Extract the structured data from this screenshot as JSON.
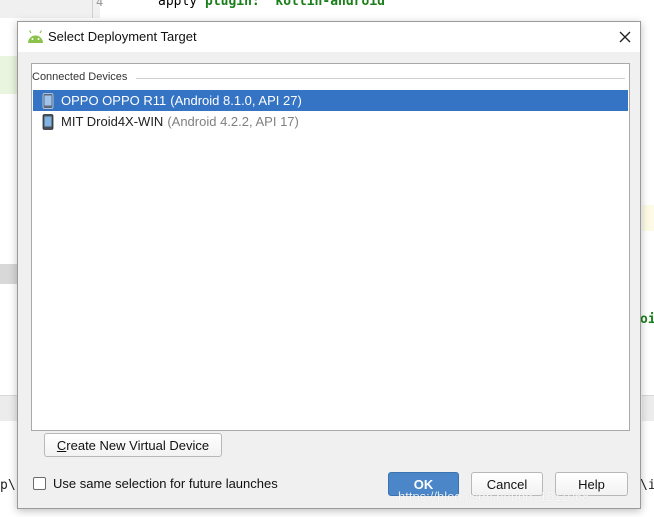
{
  "background": {
    "line_number": "4",
    "code_prefix": "apply ",
    "code_keyword": "plugin: 'kotlin-android'",
    "left_fragment": "p\\",
    "right_fragment_1": "oi",
    "right_fragment_2": "\\i"
  },
  "dialog": {
    "title": "Select Deployment Target",
    "title_icon": "android-icon",
    "close_icon": "close-icon",
    "section_label": "Connected Devices",
    "devices": [
      {
        "name": "OPPO OPPO R11",
        "detail": "(Android 8.1.0, API 27)",
        "selected": true,
        "icon": "phone-icon"
      },
      {
        "name": "MIT Droid4X-WIN",
        "detail": "(Android 4.2.2, API 17)",
        "selected": false,
        "icon": "phone-icon"
      }
    ],
    "create_button": {
      "mnemonic": "C",
      "rest": "reate New Virtual Device"
    },
    "checkbox_label": "Use same selection for future launches",
    "ok_label": "OK",
    "cancel_label": "Cancel",
    "help_label": "Help"
  },
  "watermark": "https://blog.csdn.net/qq_1511068",
  "colors": {
    "selection": "#3573c4",
    "ok_button": "#4a86c8",
    "dialog_bg": "#f0f0f0",
    "android_green": "#8bc34a"
  }
}
